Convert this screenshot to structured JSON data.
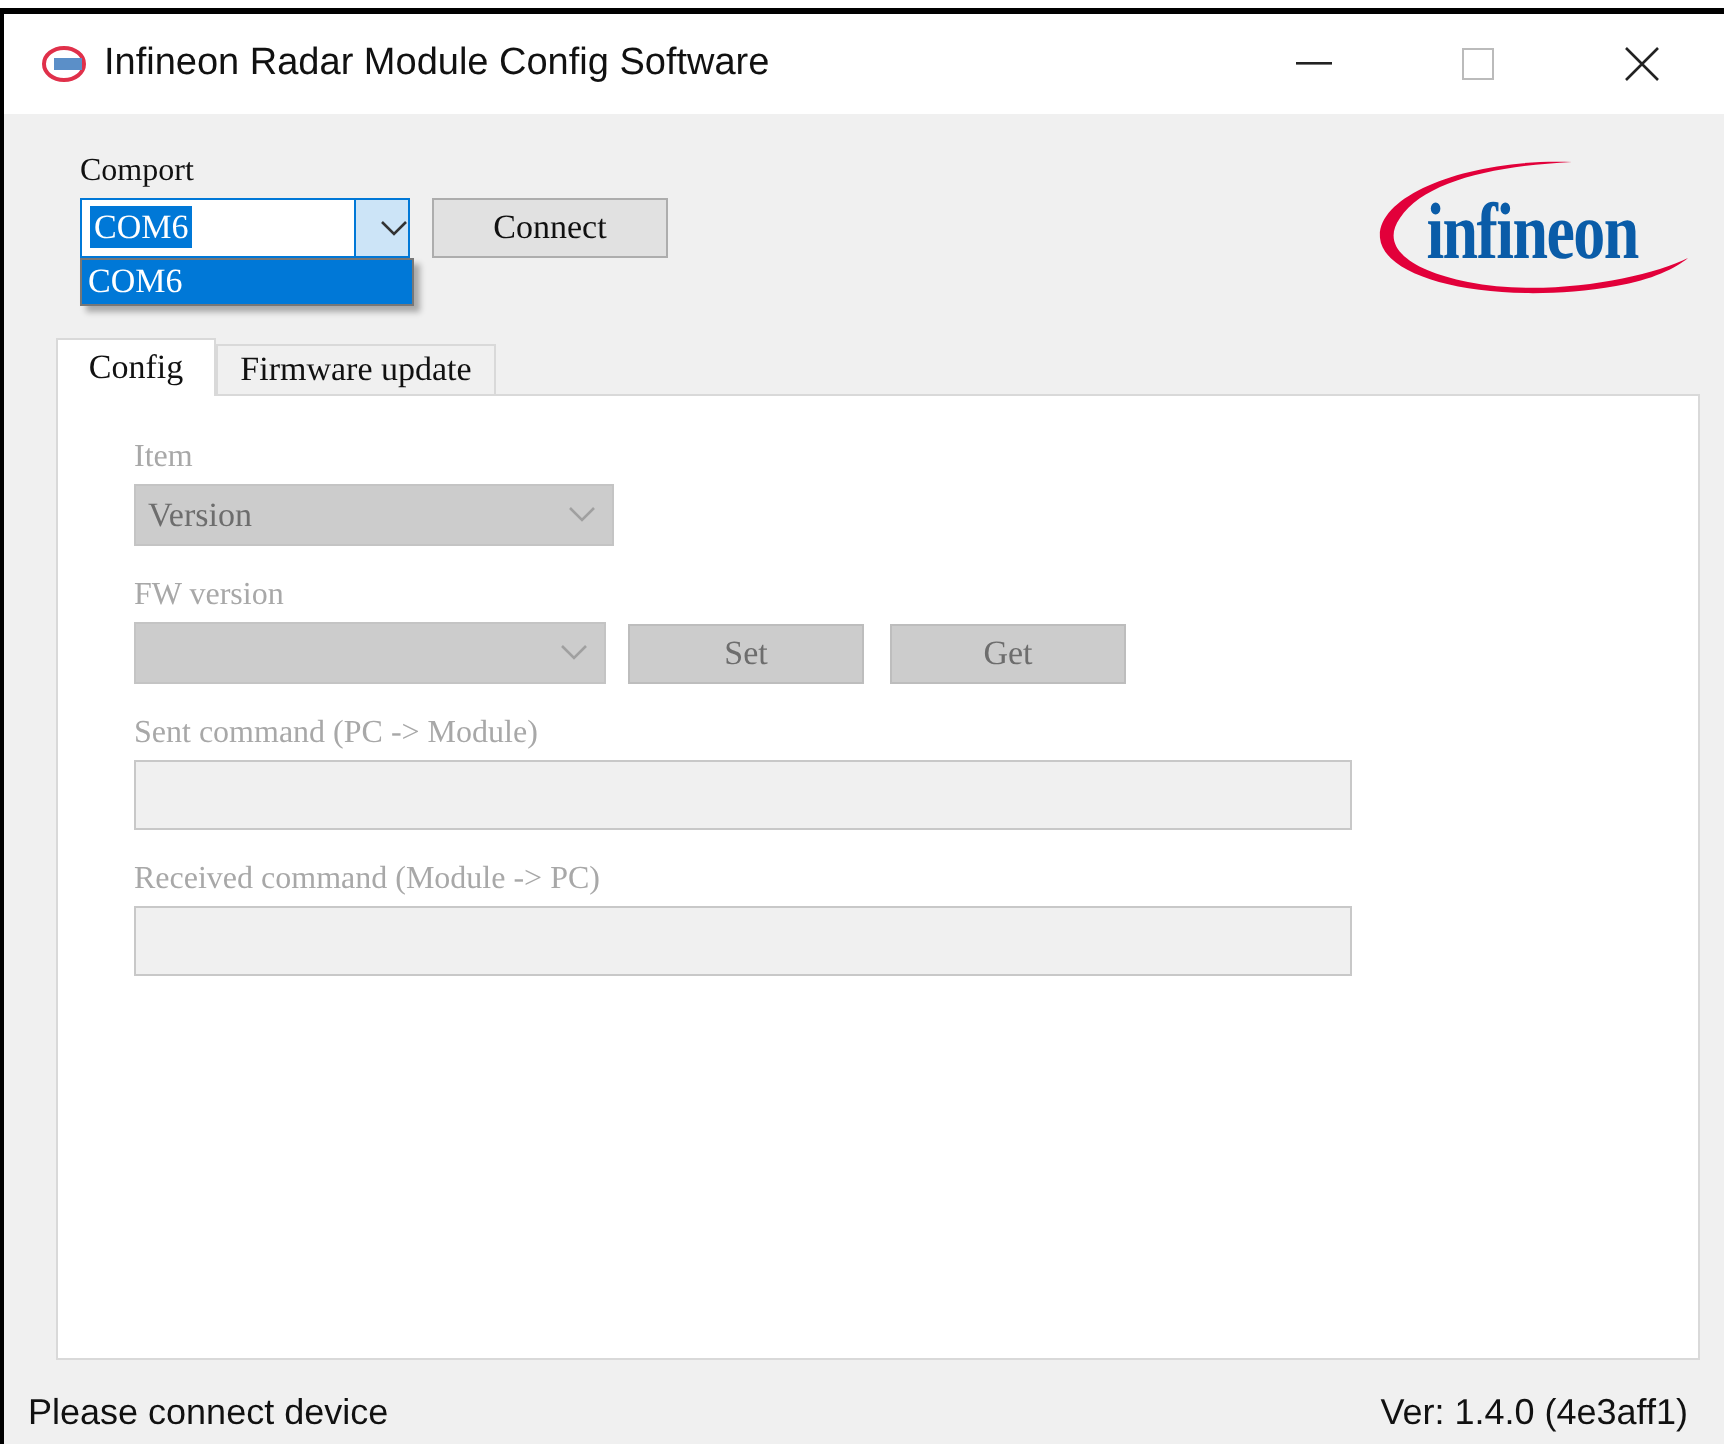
{
  "window": {
    "title": "Infineon Radar Module Config Software"
  },
  "comport": {
    "label": "Comport",
    "value": "COM6",
    "expanded": true,
    "options": [
      {
        "label": "COM6",
        "selected": true
      }
    ]
  },
  "connect_button": "Connect",
  "logo": {
    "text": "infineon"
  },
  "tabs": [
    {
      "label": "Config",
      "selected": true
    },
    {
      "label": "Firmware update",
      "selected": false
    }
  ],
  "config": {
    "disabled": true,
    "item": {
      "label": "Item",
      "value": "Version"
    },
    "fw_version": {
      "label": "FW version"
    },
    "buttons": [
      "Set",
      "Get"
    ],
    "sent": {
      "label": "Sent command (PC -> Module)"
    },
    "received": {
      "label": "Received command (Module -> PC)"
    }
  },
  "status_bar": {
    "message": "Please connect device",
    "version": "Ver: 1.4.0 (4e3aff1)"
  }
}
